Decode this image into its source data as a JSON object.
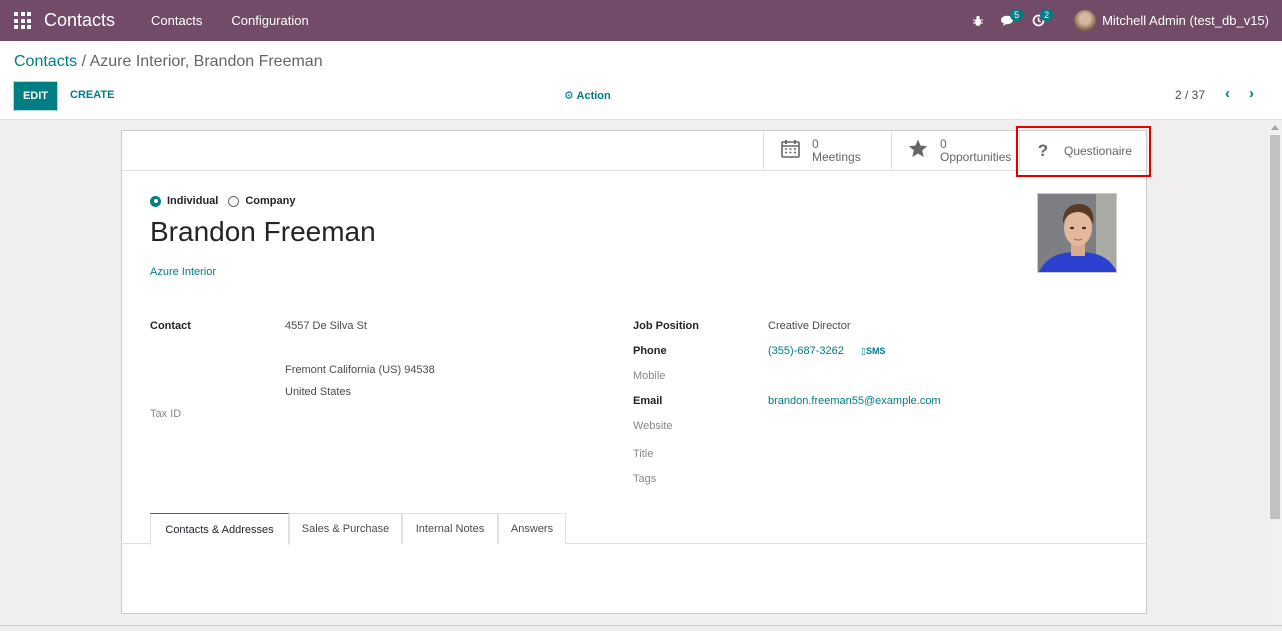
{
  "navbar": {
    "app_name": "Contacts",
    "menu": [
      "Contacts",
      "Configuration"
    ],
    "messages_count": "5",
    "activities_count": "2",
    "user": "Mitchell Admin (test_db_v15)"
  },
  "breadcrumb": {
    "parent": "Contacts",
    "separator": " / ",
    "current": "Azure Interior, Brandon Freeman"
  },
  "toolbar": {
    "edit_label": "EDIT",
    "create_label": "CREATE",
    "action_label": "⚙ Action",
    "pager": "2 / 37"
  },
  "smart_buttons": {
    "meetings": {
      "value": "0",
      "label": "Meetings"
    },
    "opportunities": {
      "value": "0",
      "label": "Opportunities"
    },
    "questionaire": {
      "label": "Questionaire"
    }
  },
  "form": {
    "type_individual": "Individual",
    "type_company": "Company",
    "name": "Brandon Freeman",
    "company": "Azure Interior",
    "left": {
      "contact_label": "Contact",
      "street": "4557 De Silva St",
      "city_line": "Fremont  California (US)  94538",
      "country": "United States",
      "tax_label": "Tax ID"
    },
    "right": {
      "job_label": "Job Position",
      "job_value": "Creative Director",
      "phone_label": "Phone",
      "phone_value": "(355)-687-3262",
      "sms_label": "▯SMS",
      "mobile_label": "Mobile",
      "email_label": "Email",
      "email_value": "brandon.freeman55@example.com",
      "website_label": "Website",
      "title_label": "Title",
      "tags_label": "Tags"
    }
  },
  "tabs": [
    "Contacts & Addresses",
    "Sales & Purchase",
    "Internal Notes",
    "Answers"
  ],
  "colors": {
    "brand": "#714b67",
    "accent": "#017e84",
    "highlight": "#e00000"
  }
}
